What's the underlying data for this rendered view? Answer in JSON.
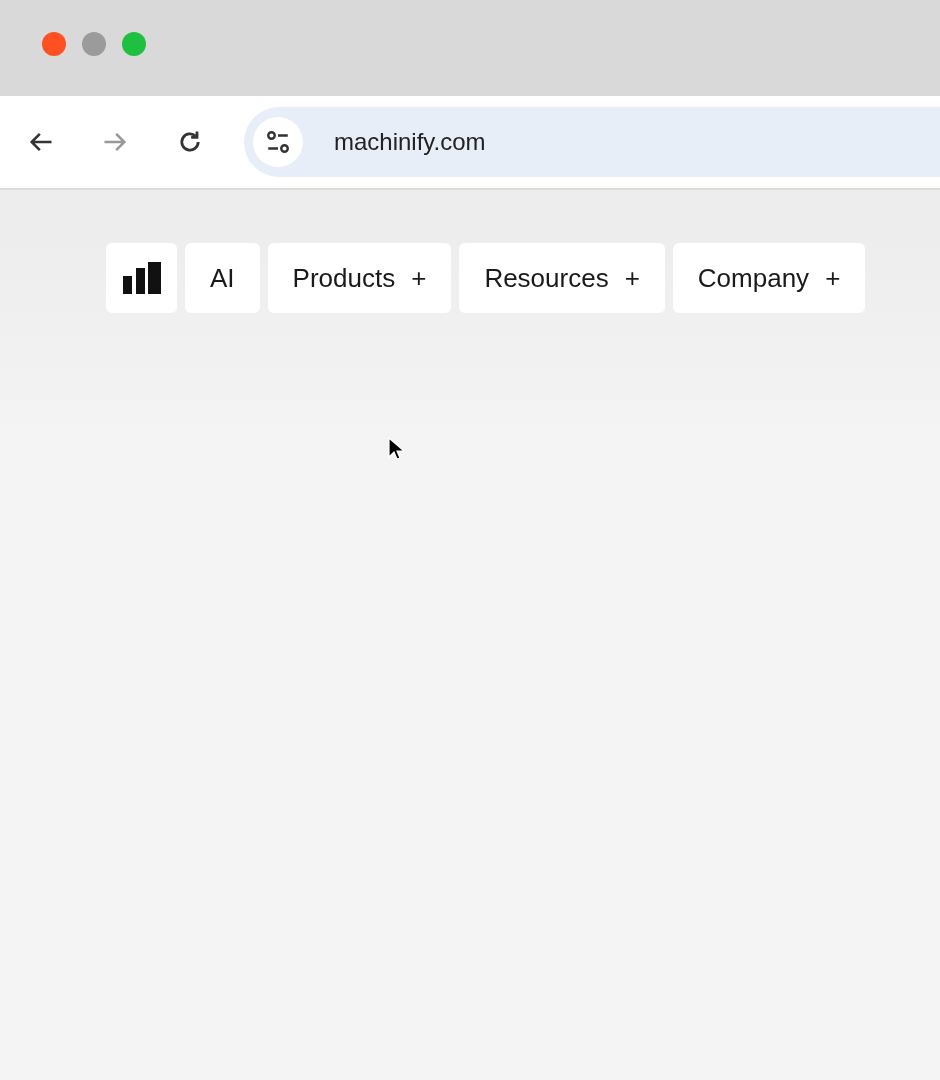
{
  "browser": {
    "address": "machinify.com"
  },
  "nav": {
    "items": [
      {
        "label": "AI"
      },
      {
        "label": "Products",
        "expand_glyph": "+"
      },
      {
        "label": "Resources",
        "expand_glyph": "+"
      },
      {
        "label": "Company",
        "expand_glyph": "+"
      }
    ]
  }
}
